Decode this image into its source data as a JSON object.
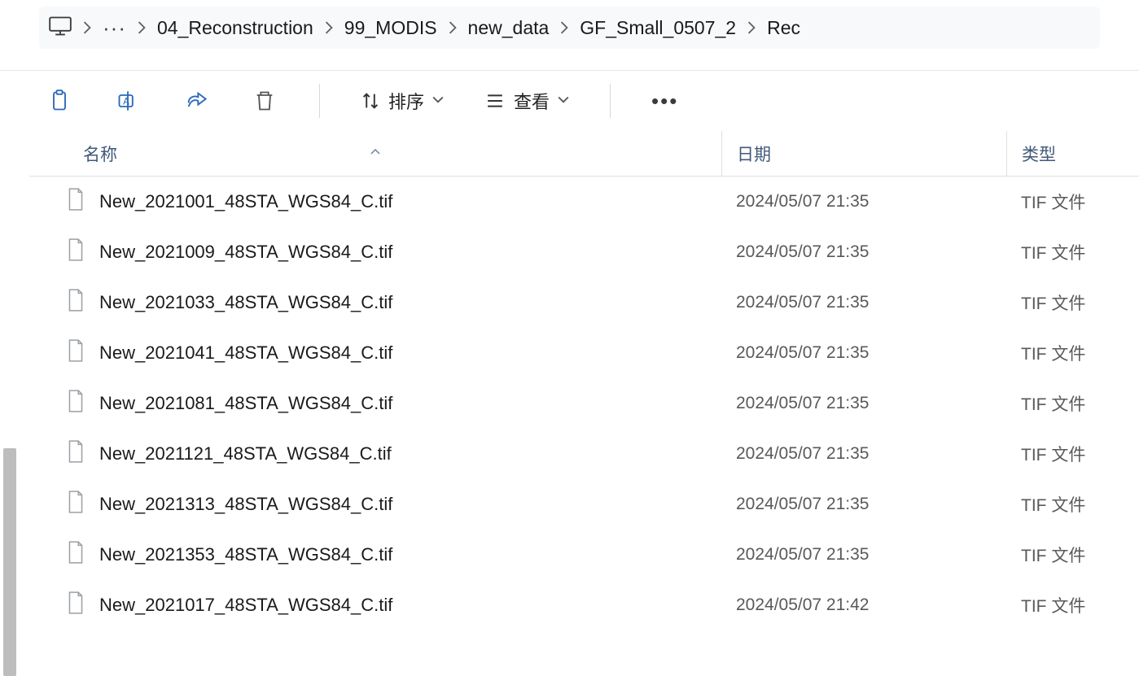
{
  "breadcrumb": {
    "items": [
      "04_Reconstruction",
      "99_MODIS",
      "new_data",
      "GF_Small_0507_2",
      "Rec"
    ]
  },
  "toolbar": {
    "sort_label": "排序",
    "view_label": "查看"
  },
  "columns": {
    "name": "名称",
    "date": "日期",
    "type": "类型"
  },
  "files": [
    {
      "name": "New_2021001_48STA_WGS84_C.tif",
      "date": "2024/05/07 21:35",
      "type": "TIF 文件"
    },
    {
      "name": "New_2021009_48STA_WGS84_C.tif",
      "date": "2024/05/07 21:35",
      "type": "TIF 文件"
    },
    {
      "name": "New_2021033_48STA_WGS84_C.tif",
      "date": "2024/05/07 21:35",
      "type": "TIF 文件"
    },
    {
      "name": "New_2021041_48STA_WGS84_C.tif",
      "date": "2024/05/07 21:35",
      "type": "TIF 文件"
    },
    {
      "name": "New_2021081_48STA_WGS84_C.tif",
      "date": "2024/05/07 21:35",
      "type": "TIF 文件"
    },
    {
      "name": "New_2021121_48STA_WGS84_C.tif",
      "date": "2024/05/07 21:35",
      "type": "TIF 文件"
    },
    {
      "name": "New_2021313_48STA_WGS84_C.tif",
      "date": "2024/05/07 21:35",
      "type": "TIF 文件"
    },
    {
      "name": "New_2021353_48STA_WGS84_C.tif",
      "date": "2024/05/07 21:35",
      "type": "TIF 文件"
    },
    {
      "name": "New_2021017_48STA_WGS84_C.tif",
      "date": "2024/05/07 21:42",
      "type": "TIF 文件"
    }
  ]
}
